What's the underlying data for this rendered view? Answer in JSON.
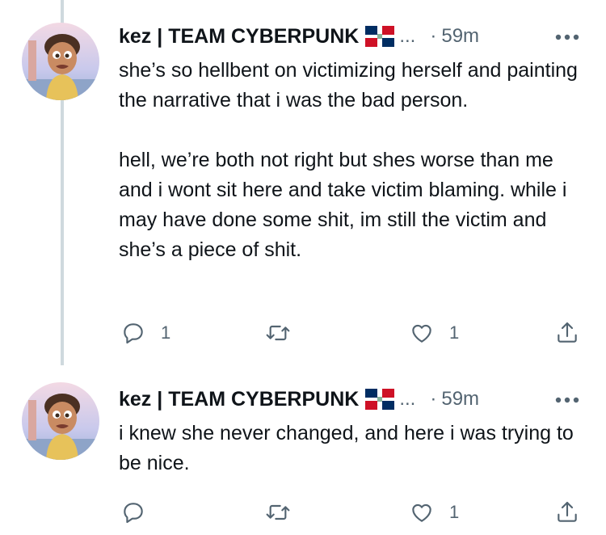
{
  "tweets": [
    {
      "author": "kez | TEAM CYBERPUNK",
      "ellipsis": "...",
      "separator": "·",
      "time": "59m",
      "text": "she’s so hellbent on victimizing herself and painting the narrative that i was the bad person.\n\nhell, we’re both not right but shes worse than me and i wont sit here and take victim blaming. while i may have done some shit, im still the victim and she’s a piece of shit.",
      "reply_count": "1",
      "retweet_count": "",
      "like_count": "1"
    },
    {
      "author": "kez | TEAM CYBERPUNK",
      "ellipsis": "...",
      "separator": "·",
      "time": "59m",
      "text": "i knew she never changed, and here i was trying to be nice.",
      "reply_count": "",
      "retweet_count": "",
      "like_count": "1"
    }
  ],
  "icons": {
    "reply": "reply-icon",
    "retweet": "retweet-icon",
    "like": "heart-icon",
    "share": "share-icon",
    "more": "more-icon",
    "flag": "dominican-republic-flag-icon"
  },
  "colors": {
    "text": "#0f1419",
    "secondary": "#536471",
    "thread_line": "#cfd9de"
  }
}
